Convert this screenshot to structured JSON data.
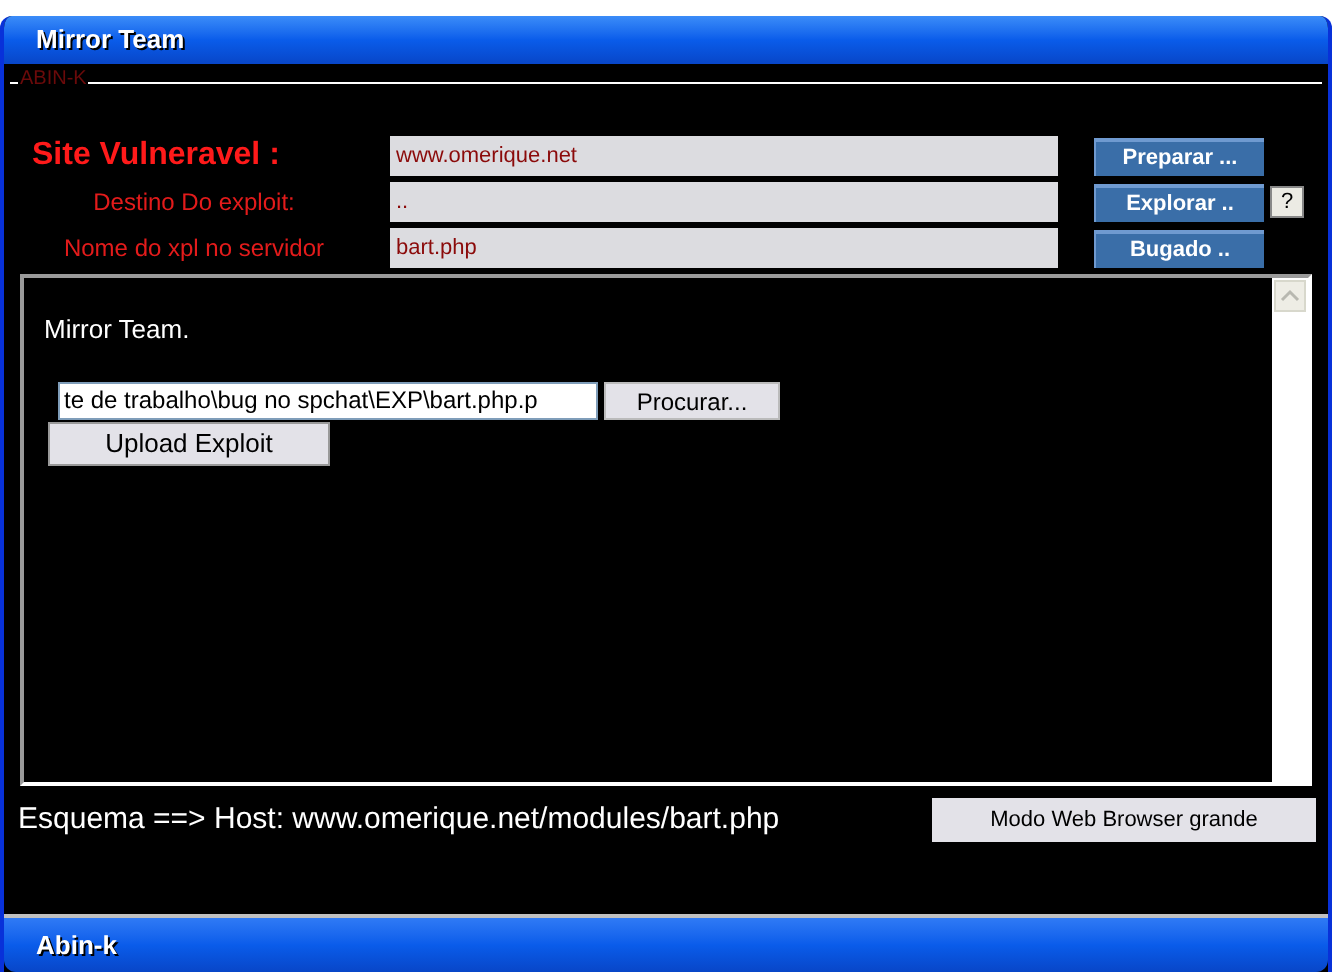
{
  "window": {
    "title": "Mirror Team"
  },
  "group": {
    "legend": "ABIN-K"
  },
  "fields": [
    {
      "kind": "headline",
      "label": "Site Vulneravel :",
      "value": "www.omerique.net",
      "button": "Preparar ..."
    },
    {
      "kind": "normal",
      "label": "Destino Do exploit:",
      "value": "..",
      "button": "Explorar ..",
      "help": "?"
    },
    {
      "kind": "normal",
      "label": "Nome do xpl no servidor",
      "value": "bart.php",
      "button": "Bugado .."
    }
  ],
  "panel": {
    "heading": "Mirror Team.",
    "file_value": "te de trabalho\\bug no spchat\\EXP\\bart.php.p",
    "browse_button": "Procurar...",
    "upload_button": "Upload Exploit"
  },
  "footer": {
    "scheme": "Esquema ==> Host: www.omerique.net/modules/bart.php",
    "browser_button": "Modo Web Browser grande"
  },
  "status_bar": {
    "title": "Abin-k"
  }
}
